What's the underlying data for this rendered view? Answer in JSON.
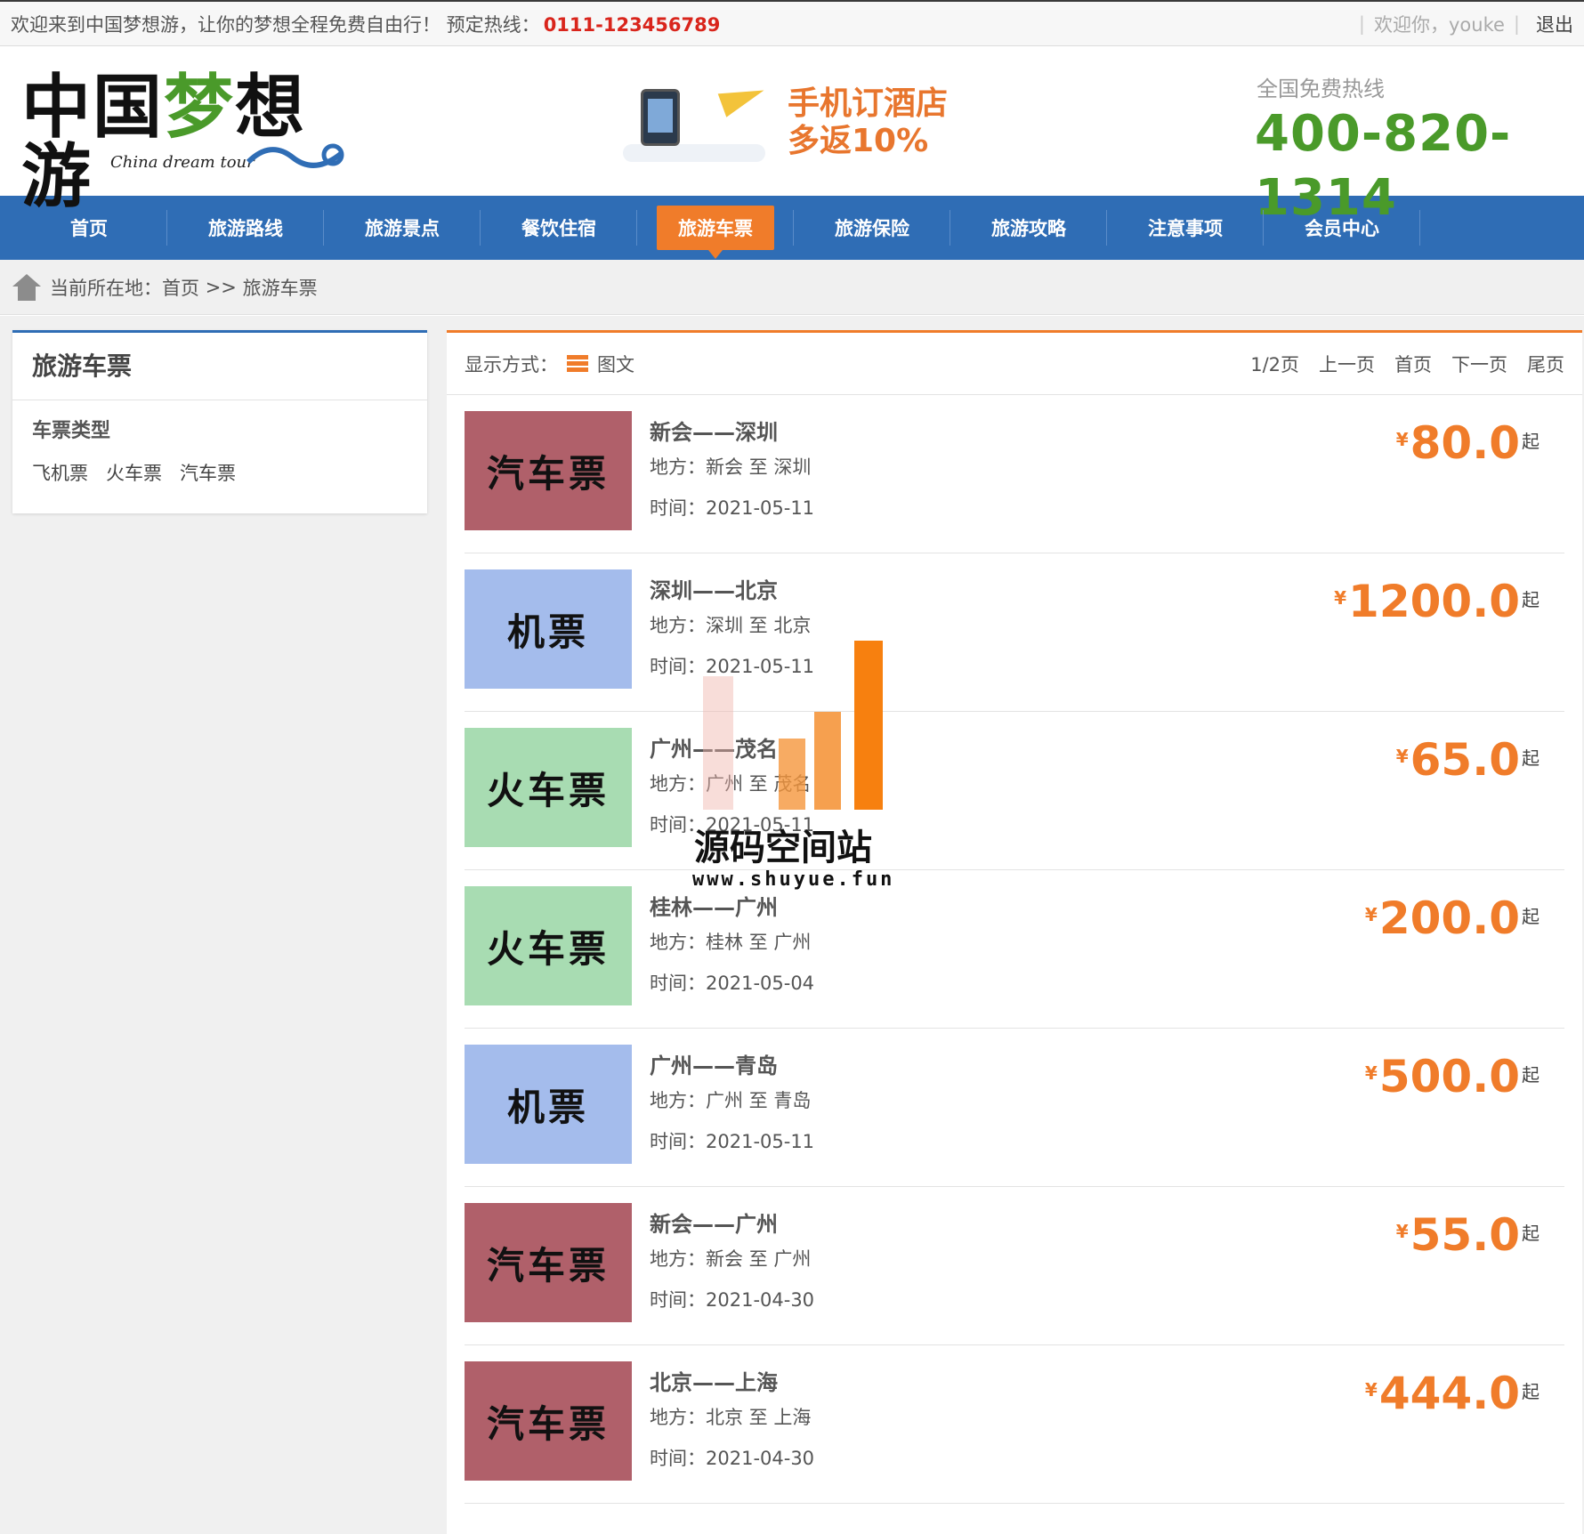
{
  "topbar": {
    "welcome_msg": "欢迎来到中国梦想游，让你的梦想全程免费自由行！ 预定热线：",
    "hotline": "0111-123456789",
    "user_greeting": "欢迎你，youke",
    "logout": "退出"
  },
  "header": {
    "logo_text": "中国梦想游",
    "logo_subtitle": "China dream tour",
    "promo_line1": "手机订酒店",
    "promo_line2": "多返10%",
    "hotline_label": "全国免费热线",
    "hotline_number": "400-820-1314"
  },
  "nav": {
    "items": [
      "首页",
      "旅游路线",
      "旅游景点",
      "餐饮住宿",
      "旅游车票",
      "旅游保险",
      "旅游攻略",
      "注意事项",
      "会员中心"
    ],
    "active_index": 4
  },
  "breadcrumb": {
    "prefix": "当前所在地：",
    "home": "首页",
    "sep": ">>",
    "current": "旅游车票"
  },
  "sidebar": {
    "title": "旅游车票",
    "subtitle": "车票类型",
    "links": [
      "飞机票",
      "火车票",
      "汽车票"
    ]
  },
  "toolbar": {
    "mode_label": "显示方式：",
    "mode_value": "图文",
    "page_info": "1/2页",
    "prev": "上一页",
    "first": "首页",
    "next": "下一页",
    "last": "尾页"
  },
  "tickets": [
    {
      "thumb": "汽车票",
      "thumb_color": "#b0606a",
      "route": "新会——深圳",
      "place": "地方：新会 至 深圳",
      "date": "时间：2021-05-11",
      "price": "80.0"
    },
    {
      "thumb": "机票",
      "thumb_color": "#a4bcec",
      "route": "深圳——北京",
      "place": "地方：深圳 至 北京",
      "date": "时间：2021-05-11",
      "price": "1200.0"
    },
    {
      "thumb": "火车票",
      "thumb_color": "#a8dcb2",
      "route": "广州——茂名",
      "place": "地方：广州 至 茂名",
      "date": "时间：2021-05-11",
      "price": "65.0"
    },
    {
      "thumb": "火车票",
      "thumb_color": "#a8dcb2",
      "route": "桂林——广州",
      "place": "地方：桂林 至 广州",
      "date": "时间：2021-05-04",
      "price": "200.0"
    },
    {
      "thumb": "机票",
      "thumb_color": "#a4bcec",
      "route": "广州——青岛",
      "place": "地方：广州 至 青岛",
      "date": "时间：2021-05-11",
      "price": "500.0"
    },
    {
      "thumb": "汽车票",
      "thumb_color": "#b0606a",
      "route": "新会——广州",
      "place": "地方：新会 至 广州",
      "date": "时间：2021-04-30",
      "price": "55.0"
    },
    {
      "thumb": "汽车票",
      "thumb_color": "#b0606a",
      "route": "北京——上海",
      "place": "地方：北京 至 上海",
      "date": "时间：2021-04-30",
      "price": "444.0"
    }
  ],
  "price_currency": "¥",
  "price_suffix": "起",
  "watermark": {
    "title": "源码空间站",
    "url": "www.shuyue.fun"
  },
  "colors": {
    "nav_blue": "#2f6db5",
    "accent_orange": "#f07c2a",
    "hotline_green": "#4a9a2a",
    "hot_red": "#d9251c"
  }
}
